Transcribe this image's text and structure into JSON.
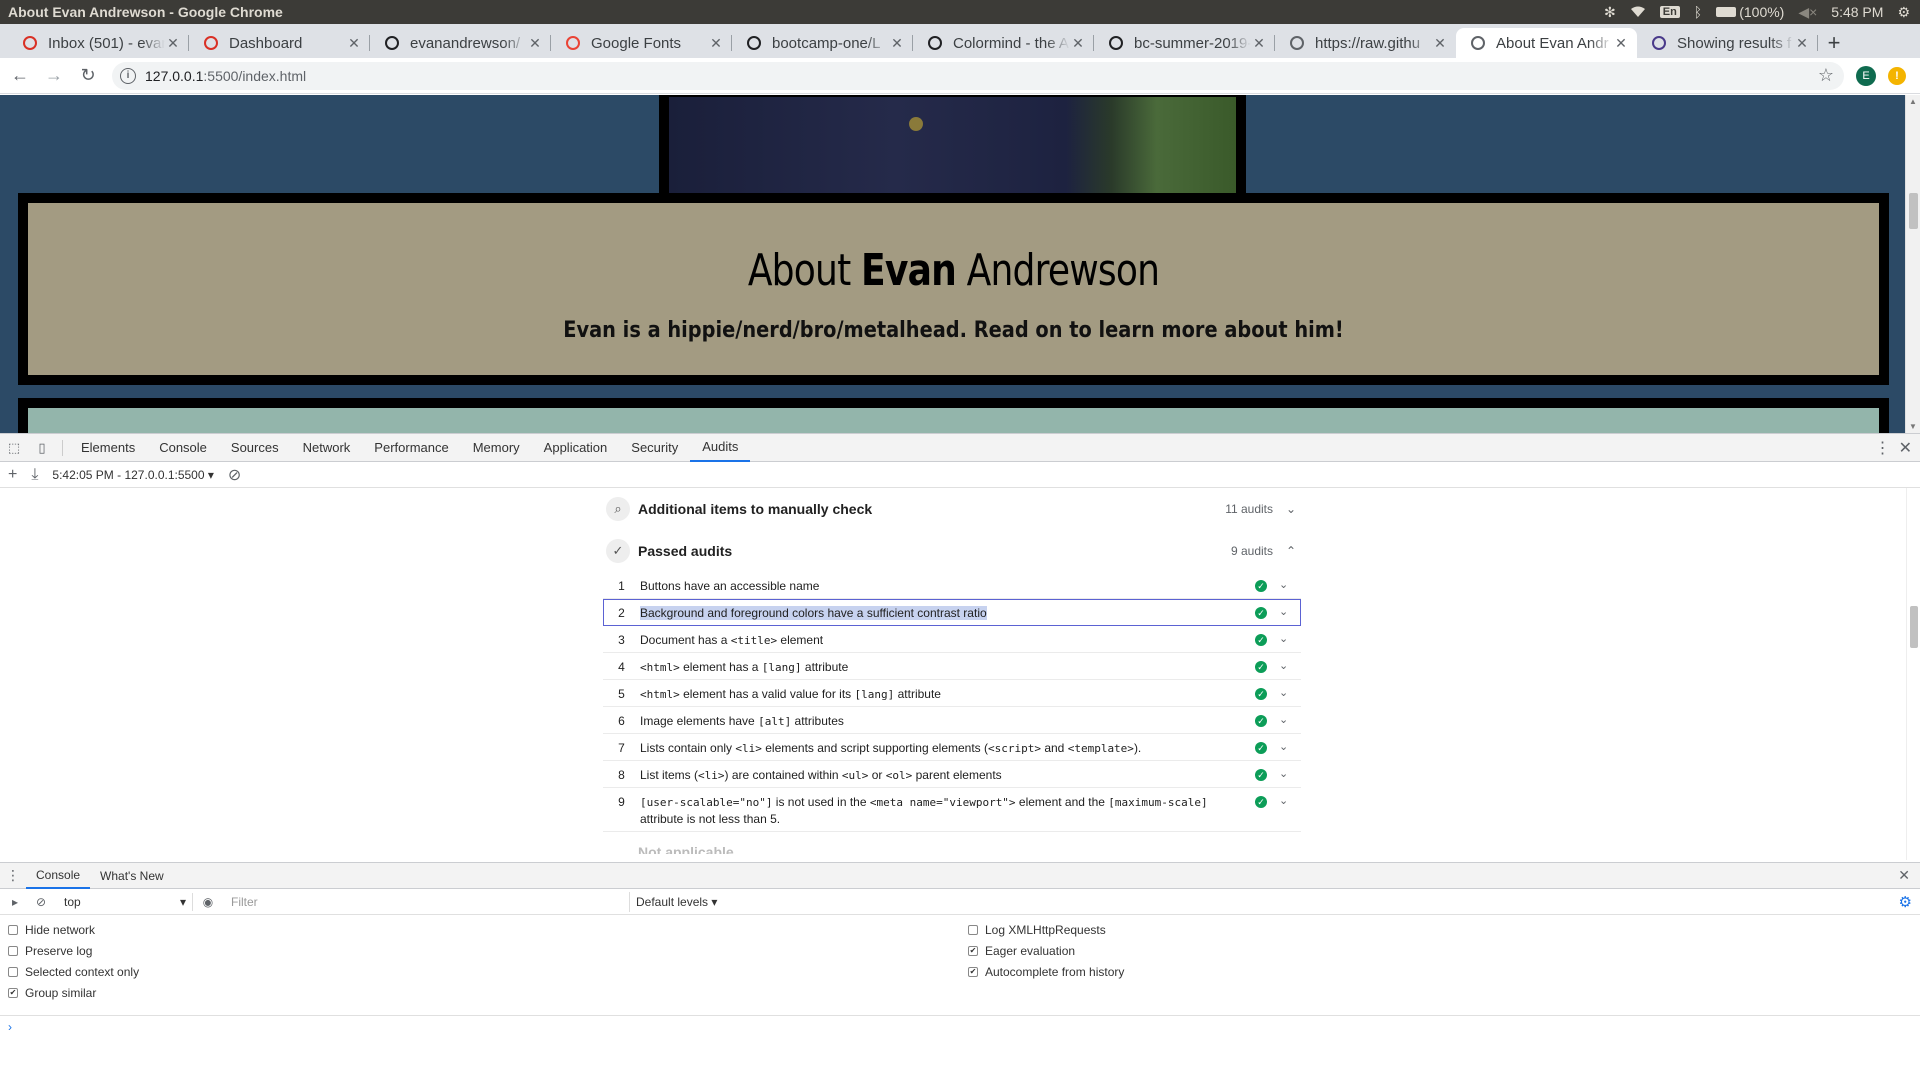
{
  "os_bar": {
    "window_title": "About Evan Andrewson - Google Chrome",
    "keyboard_lang": "En",
    "battery": "(100%)",
    "time": "5:48 PM"
  },
  "tabs": [
    {
      "title": "Inbox (501) - evan",
      "icon": "gmail-icon",
      "color": "#d93025"
    },
    {
      "title": "Dashboard",
      "icon": "dashboard-icon",
      "color": "#d93025"
    },
    {
      "title": "evanandrewson/",
      "icon": "github-icon",
      "color": "#202124"
    },
    {
      "title": "Google Fonts",
      "icon": "google-fonts-icon",
      "color": "#ea4335"
    },
    {
      "title": "bootcamp-one/L",
      "icon": "github-icon",
      "color": "#202124"
    },
    {
      "title": "Colormind - the A",
      "icon": "colormind-icon",
      "color": "#202124"
    },
    {
      "title": "bc-summer-2019-",
      "icon": "github-icon",
      "color": "#202124"
    },
    {
      "title": "https://raw.githu",
      "icon": "globe-icon",
      "color": "#5f6368"
    },
    {
      "title": "About Evan Andr",
      "icon": "globe-icon",
      "color": "#5f6368",
      "active": true
    },
    {
      "title": "Showing results f",
      "icon": "wolf-icon",
      "color": "#4a3a8a"
    }
  ],
  "address_bar": {
    "host": "127.0.0.1",
    "path": ":5500/index.html",
    "avatar_letter": "E"
  },
  "page": {
    "heading_pre": "About ",
    "heading_bold": "Evan",
    "heading_post": " Andrewson",
    "tagline": "Evan is a hippie/nerd/bro/metalhead. Read on to learn more about him!"
  },
  "devtools": {
    "tabs": [
      "Elements",
      "Console",
      "Sources",
      "Network",
      "Performance",
      "Memory",
      "Application",
      "Security",
      "Audits"
    ],
    "active_tab": "Audits",
    "audit_run": "5:42:05 PM - 127.0.0.1:5500"
  },
  "report": {
    "manual": {
      "label": "Additional items to manually check",
      "count": "11 audits"
    },
    "passed": {
      "label": "Passed audits",
      "count": "9 audits"
    },
    "next_group_partial": "Not applicable",
    "audits": [
      {
        "n": "1",
        "parts": [
          [
            "Buttons have an accessible name",
            false
          ]
        ]
      },
      {
        "n": "2",
        "parts": [
          [
            "Background and foreground colors have a sufficient contrast ratio",
            false
          ]
        ],
        "selected": true
      },
      {
        "n": "3",
        "parts": [
          [
            "Document has a ",
            false
          ],
          [
            "<title>",
            true
          ],
          [
            " element",
            false
          ]
        ]
      },
      {
        "n": "4",
        "parts": [
          [
            "<html>",
            true
          ],
          [
            " element has a ",
            false
          ],
          [
            "[lang]",
            true
          ],
          [
            " attribute",
            false
          ]
        ]
      },
      {
        "n": "5",
        "parts": [
          [
            "<html>",
            true
          ],
          [
            " element has a valid value for its ",
            false
          ],
          [
            "[lang]",
            true
          ],
          [
            " attribute",
            false
          ]
        ]
      },
      {
        "n": "6",
        "parts": [
          [
            "Image elements have ",
            false
          ],
          [
            "[alt]",
            true
          ],
          [
            " attributes",
            false
          ]
        ]
      },
      {
        "n": "7",
        "parts": [
          [
            "Lists contain only ",
            false
          ],
          [
            "<li>",
            true
          ],
          [
            " elements and script supporting elements (",
            false
          ],
          [
            "<script>",
            true
          ],
          [
            " and ",
            false
          ],
          [
            "<template>",
            true
          ],
          [
            ").",
            false
          ]
        ]
      },
      {
        "n": "8",
        "parts": [
          [
            "List items (",
            false
          ],
          [
            "<li>",
            true
          ],
          [
            ") are contained within ",
            false
          ],
          [
            "<ul>",
            true
          ],
          [
            " or ",
            false
          ],
          [
            "<ol>",
            true
          ],
          [
            " parent elements",
            false
          ]
        ]
      },
      {
        "n": "9",
        "parts": [
          [
            "[user-scalable=\"no\"]",
            true
          ],
          [
            " is not used in the ",
            false
          ],
          [
            "<meta name=\"viewport\">",
            true
          ],
          [
            " element and the ",
            false
          ],
          [
            "[maximum-scale]",
            true
          ],
          [
            " attribute is not less than 5.",
            false
          ]
        ]
      }
    ]
  },
  "drawer": {
    "tabs": [
      "Console",
      "What's New"
    ],
    "active_tab": "Console",
    "context": "top",
    "filter_placeholder": "Filter",
    "levels": "Default levels",
    "left_options": [
      {
        "label": "Hide network",
        "checked": false
      },
      {
        "label": "Preserve log",
        "checked": false
      },
      {
        "label": "Selected context only",
        "checked": false
      },
      {
        "label": "Group similar",
        "checked": true
      }
    ],
    "right_options": [
      {
        "label": "Log XMLHttpRequests",
        "checked": false
      },
      {
        "label": "Eager evaluation",
        "checked": true
      },
      {
        "label": "Autocomplete from history",
        "checked": true
      }
    ]
  }
}
